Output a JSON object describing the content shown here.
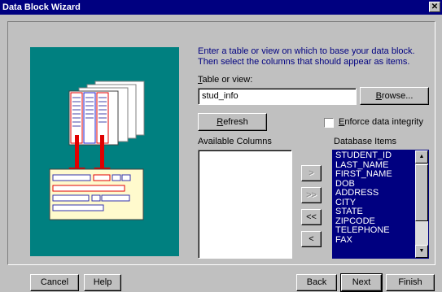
{
  "window": {
    "title": "Data Block Wizard",
    "close_glyph": "✕"
  },
  "instruction": {
    "line1": "Enter a table or view on which to base your data block.",
    "line2": "Then select the columns that should appear as items."
  },
  "table_field": {
    "label_first": "T",
    "label_rest": "able or view:",
    "value": "stud_info"
  },
  "buttons": {
    "browse_first": "B",
    "browse_rest": "rowse...",
    "refresh_first": "R",
    "refresh_rest": "efresh",
    "move_one_right": ">",
    "move_all_right": ">>",
    "move_all_left": "<<",
    "move_one_left": "<",
    "cancel": "Cancel",
    "help": "Help",
    "back": "Back",
    "next": "Next",
    "finish": "Finish"
  },
  "enforce": {
    "first": "E",
    "rest": "nforce data integrity",
    "checked": false
  },
  "available_columns": {
    "label": "Available Columns",
    "items": []
  },
  "database_items": {
    "label": "Database Items",
    "items": [
      "STUDENT_ID",
      "LAST_NAME",
      "FIRST_NAME",
      "DOB",
      "ADDRESS",
      "CITY",
      "STATE",
      "ZIPCODE",
      "TELEPHONE",
      "FAX"
    ]
  },
  "colors": {
    "titlebar": "#000080",
    "illustration_bg": "#008080",
    "selection": "#000080",
    "instruction_text": "#000080"
  }
}
